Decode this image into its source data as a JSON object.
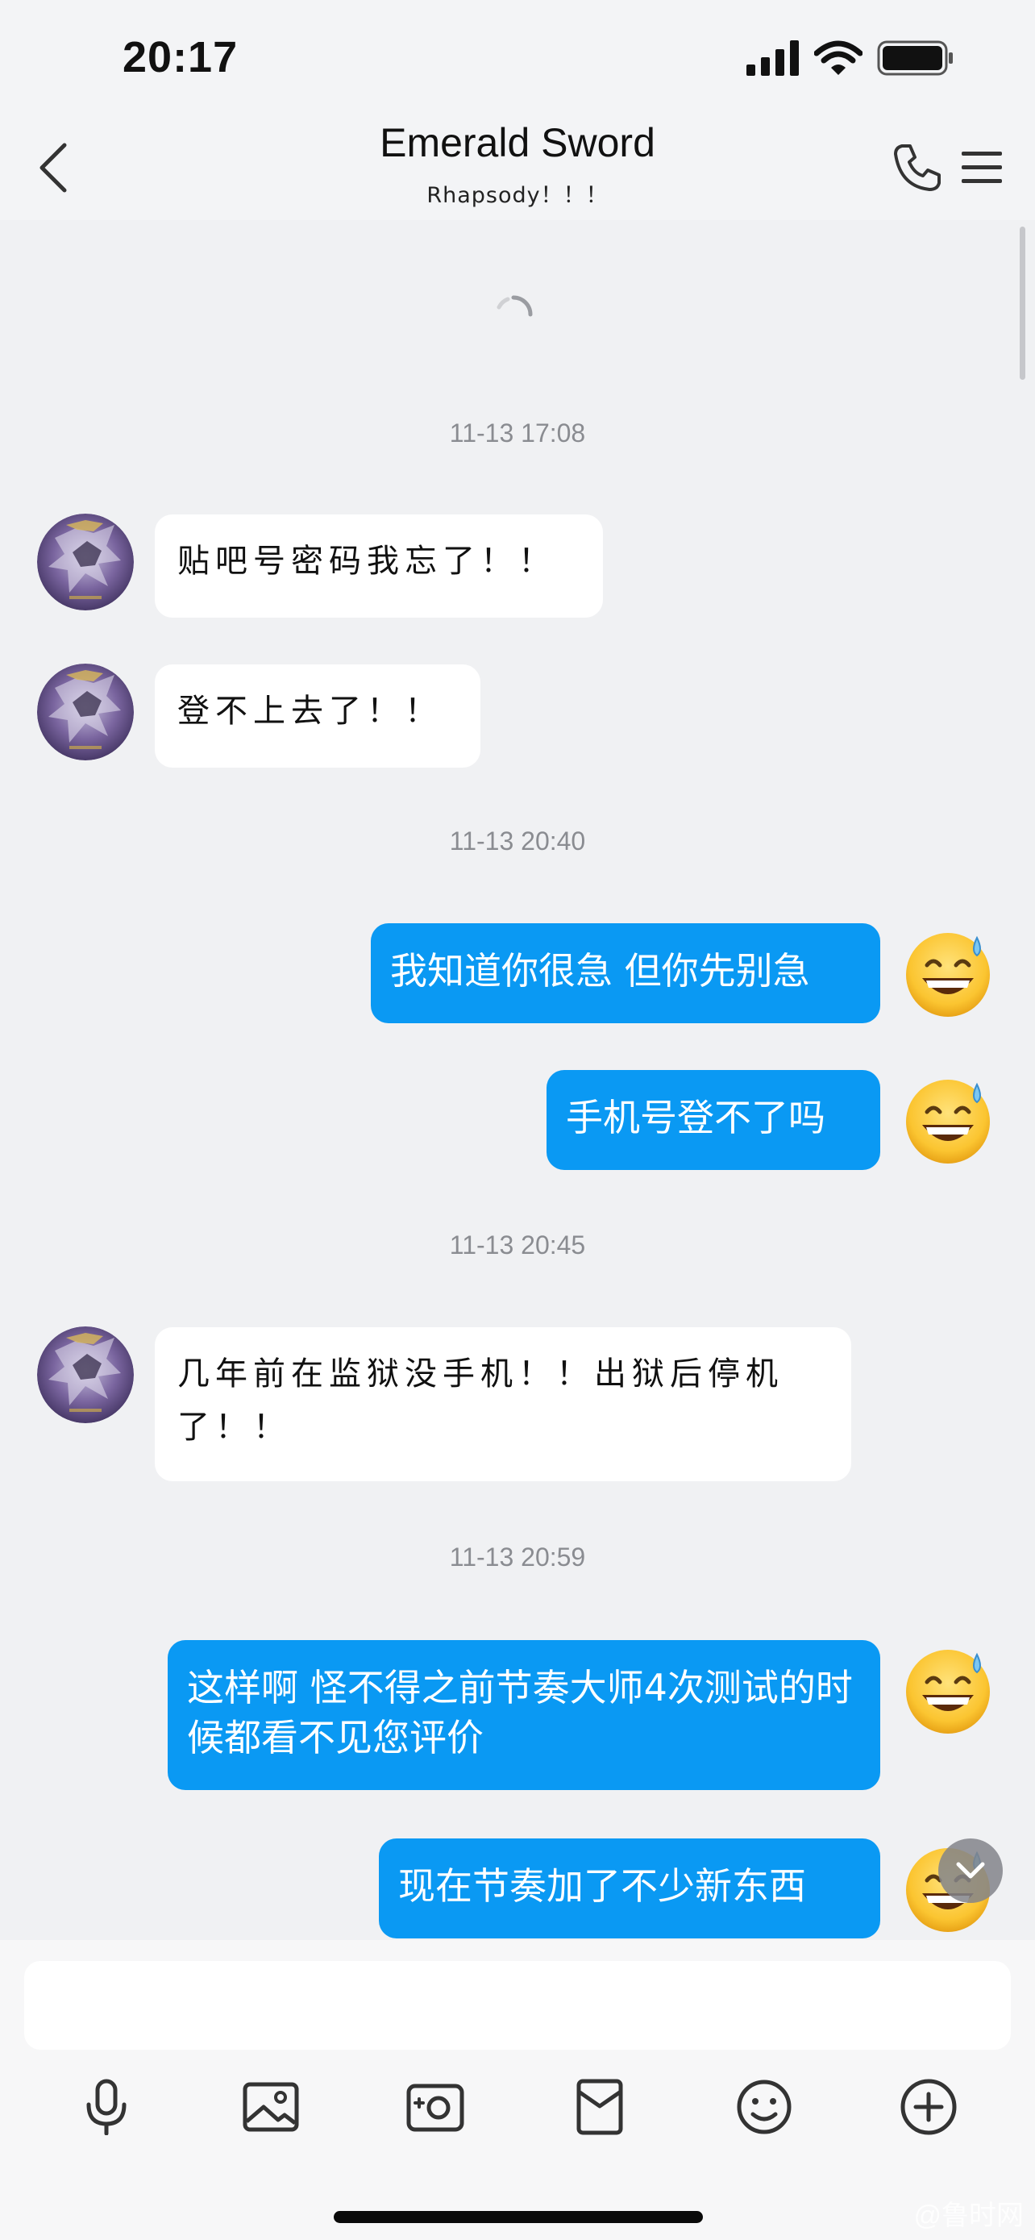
{
  "status_bar": {
    "time": "20:17"
  },
  "header": {
    "title": "Emerald Sword",
    "subtitle": "Rhapsody！！！"
  },
  "messages": [
    {
      "type": "timestamp",
      "text": "11-13 17:08"
    },
    {
      "type": "incoming",
      "text": "贴吧号密码我忘了！！"
    },
    {
      "type": "incoming",
      "text": "登不上去了！！"
    },
    {
      "type": "timestamp",
      "text": "11-13 20:40"
    },
    {
      "type": "outgoing",
      "text": "我知道你很急 但你先别急"
    },
    {
      "type": "outgoing",
      "text": "手机号登不了吗"
    },
    {
      "type": "timestamp",
      "text": "11-13 20:45"
    },
    {
      "type": "incoming",
      "text": "几年前在监狱没手机！！出狱后停机了！！"
    },
    {
      "type": "timestamp",
      "text": "11-13 20:59"
    },
    {
      "type": "outgoing",
      "text": "这样啊 怪不得之前节奏大师4次测试的时候都看不见您评价"
    },
    {
      "type": "outgoing",
      "text": "现在节奏加了不少新东西"
    }
  ],
  "input": {
    "placeholder": ""
  },
  "toolbar": [
    "microphone-icon",
    "image-icon",
    "camera-icon",
    "red-envelope-icon",
    "emoji-icon",
    "plus-icon"
  ],
  "colors": {
    "outgoing_bubble": "#0a99f3",
    "incoming_bubble": "#ffffff",
    "background": "#f0f1f3"
  },
  "watermark": "@鲁时网"
}
